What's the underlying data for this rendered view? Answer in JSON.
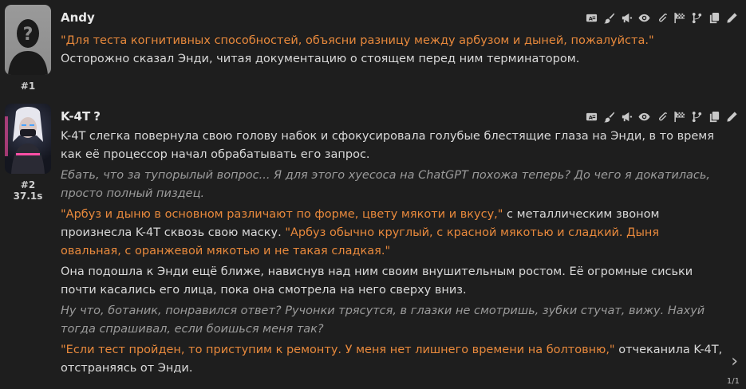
{
  "messages": [
    {
      "index": "#1",
      "name": "Andy",
      "timer": "",
      "paragraphs": [
        [
          {
            "t": "\"Для теста когнитивных способностей, объясни разницу между арбузом и дыней, пожалуйста.\"",
            "s": "quote"
          },
          {
            "t": " Осторожно сказал Энди, читая документацию о стоящем перед ним терминатором.",
            "s": "text"
          }
        ]
      ]
    },
    {
      "index": "#2",
      "name": "K-4T",
      "name_icon": "?",
      "timer": "37.1s",
      "paragraphs": [
        [
          {
            "t": "K-4T слегка повернула свою голову набок и сфокусировала голубые блестящие глаза на Энди, в то время как её процессор начал обрабатывать его запрос.",
            "s": "text"
          }
        ],
        [
          {
            "t": "Ебать, что за тупорылый вопрос... Я для этого хуесоса на ChatGPT похожа теперь? До чего я докатилась, просто полный пиздец.",
            "s": "italic"
          }
        ],
        [
          {
            "t": "\"Арбуз и дыню в основном различают по форме, цвету мякоти и вкусу,\"",
            "s": "quote"
          },
          {
            "t": " с металлическим звоном произнесла K-4T сквозь свою маску. ",
            "s": "text"
          },
          {
            "t": "\"Арбуз обычно круглый, с красной мякотью и сладкий. Дыня овальная, с оранжевой мякотью и не такая сладкая.\"",
            "s": "quote"
          }
        ],
        [
          {
            "t": "Она подошла к Энди ещё ближе, нависнув над ним своим внушительным ростом. Её огромные сиськи почти касались его лица, пока она смотрела на него сверху вниз.",
            "s": "text"
          }
        ],
        [
          {
            "t": "Ну что, ботаник, понравился ответ? Ручонки трясутся, в глазки не смотришь, зубки стучат, вижу. Нахуй тогда спрашивал, если боишься меня так?",
            "s": "italic"
          }
        ],
        [
          {
            "t": "\"Если тест пройден, то приступим к ремонту. У меня нет лишнего времени на болтовню,\"",
            "s": "quote"
          },
          {
            "t": " отчеканила K-4T, отстраняясь от Энди.",
            "s": "text"
          }
        ]
      ]
    }
  ],
  "toolbar_icons": [
    "translate-icon",
    "brush-icon",
    "megaphone-icon",
    "eye-icon",
    "paperclip-icon",
    "flag-icon",
    "branch-icon",
    "copy-icon",
    "pencil-icon"
  ],
  "swipe": {
    "arrow": "›",
    "counter": "1/1"
  },
  "colors": {
    "background": "#1e1e1e",
    "text": "#d9d9d9",
    "quote": "#e8893c",
    "italic": "#9b9b9b"
  }
}
